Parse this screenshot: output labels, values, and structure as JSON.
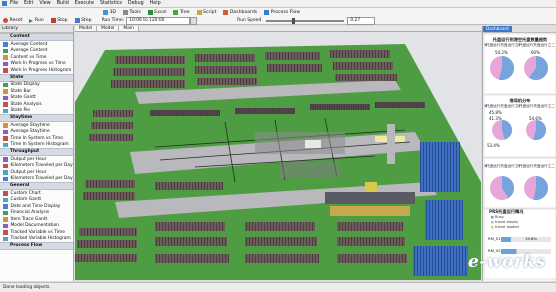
{
  "menu": [
    "File",
    "Edit",
    "View",
    "Build",
    "Execute",
    "Statistics",
    "Debug",
    "Help"
  ],
  "toolbar": {
    "reset": "Reset",
    "run": "Run",
    "stop": "Stop",
    "step": "Step",
    "run_time_label": "Run Time:",
    "run_time_value": "10:06 to 120:00",
    "tools": [
      "3D",
      "Tools",
      "Excel",
      "Tree",
      "Script",
      "Dashboards",
      "Process Flow"
    ],
    "run_speed_label": "Run Speed",
    "run_speed_value": "0.27",
    "run_speed_fraction": 0.34
  },
  "library": {
    "title": "Library",
    "groups": [
      {
        "name": "Content",
        "items": [
          "Average Content",
          "Average Content",
          "Content vs Time",
          "Work In Progress vs Time",
          "Work In Progress Histogram"
        ]
      },
      {
        "name": "State",
        "items": [
          "State Display",
          "State Bar",
          "State Gantt",
          "State Analysis",
          "State Pie"
        ]
      },
      {
        "name": "Staytime",
        "items": [
          "Average Staytime",
          "Average Staytime",
          "Time In System vs Time",
          "Time In System Histogram"
        ]
      },
      {
        "name": "Throughput",
        "items": [
          "Output per Hour",
          "Kilometers Traveled per Day",
          "Output per Hour",
          "Kilometers Traveled per Day"
        ]
      },
      {
        "name": "General",
        "items": [
          "Custom Chart",
          "Custom Gantt",
          "Date and Time Display",
          "Financial Analysis",
          "Item Trace Gantt",
          "Model Documentation",
          "Tracked Variable vs Time",
          "Tracked Variable Histogram"
        ]
      },
      {
        "name": "Process Flow",
        "items": []
      }
    ]
  },
  "tabs": [
    "Model",
    "Model",
    "Main"
  ],
  "dashboard": {
    "tab": "Dashboard",
    "chart1": {
      "title": "托盘运行到港空托盘数量趋势",
      "legend": [
        "托盘运行托盘运行之一",
        "托盘运行托盘运行之二"
      ],
      "left_label": "54.2%",
      "right_label": "60%",
      "left_value": 54.2,
      "right_value": 60
    },
    "chart2": {
      "title": "堆垛机分布",
      "legend": [
        "托盘运行托盘运行之一",
        "托盘运行托盘运行之二"
      ],
      "labels": [
        "45.8%",
        "41.3%",
        "54.6%",
        "53.4%"
      ],
      "values": [
        45.8,
        41.3,
        54.6,
        53.4
      ]
    },
    "chart3": {
      "legend": [
        "托盘运行托盘运行之一",
        "托盘运行托盘运行之二"
      ]
    },
    "chart4": {
      "title": "PRS托盘运行情况",
      "legend": [
        "Busy",
        "travel empty",
        "travel loaded"
      ],
      "rows": [
        {
          "label": "RM_01",
          "value": "19.8%",
          "fraction": 0.198
        },
        {
          "label": "RM_02",
          "value": "",
          "fraction": 0.31
        }
      ]
    }
  },
  "status": "Done loading objects.",
  "logo": {
    "text": "e-works",
    "sub": ""
  },
  "colors": {
    "floor_green": "#4f9d43",
    "road": "#b7b6ba",
    "rack": "#6b5a5a",
    "accent_blue": "#3c78c9",
    "pie_blue": "#78a4de",
    "pie_pink": "#e6a7d8"
  }
}
